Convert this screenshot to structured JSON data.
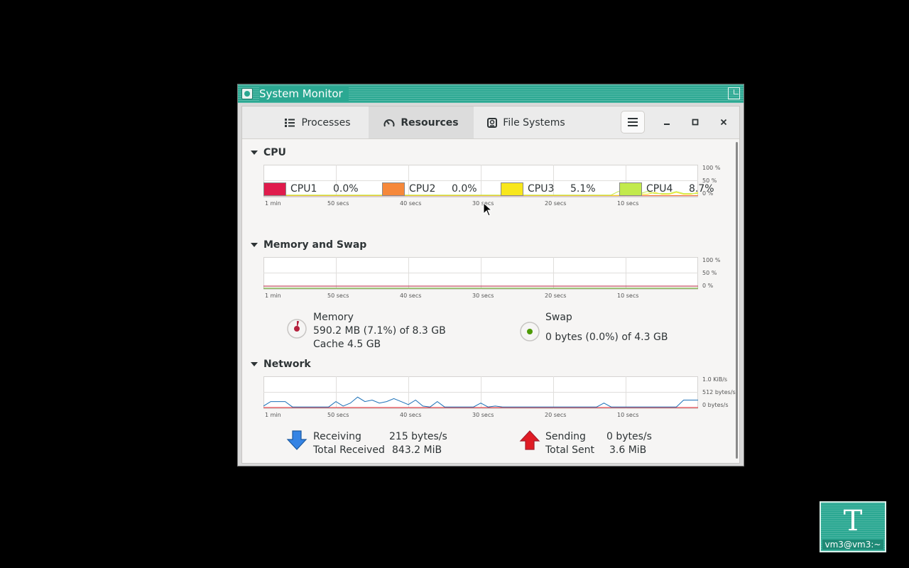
{
  "window": {
    "title": "System Monitor"
  },
  "tabs": [
    {
      "label": "Processes",
      "icon": "list-icon"
    },
    {
      "label": "Resources",
      "icon": "gauge-icon",
      "active": true
    },
    {
      "label": "File Systems",
      "icon": "disk-icon"
    }
  ],
  "sections": {
    "cpu": "CPU",
    "memory": "Memory and Swap",
    "network": "Network"
  },
  "time_labels": [
    "1 min",
    "50 secs",
    "40 secs",
    "30 secs",
    "20 secs",
    "10 secs"
  ],
  "cpu": {
    "axis": [
      "100 %",
      "50 %",
      "0 %"
    ],
    "legend": [
      {
        "name": "CPU1",
        "value": "0.0%",
        "color": "#e01b4c"
      },
      {
        "name": "CPU2",
        "value": "0.0%",
        "color": "#f6883a"
      },
      {
        "name": "CPU3",
        "value": "5.1%",
        "color": "#f8e71c"
      },
      {
        "name": "CPU4",
        "value": "8.7%",
        "color": "#c2ea4c"
      }
    ]
  },
  "memory": {
    "axis": [
      "100 %",
      "50 %",
      "0 %"
    ],
    "memory_label": "Memory",
    "memory_value": "590.2 MB (7.1%) of 8.3 GB",
    "cache": "Cache 4.5 GB",
    "memory_color": "#b5223e",
    "swap_label": "Swap",
    "swap_value": "0 bytes (0.0%) of 4.3 GB",
    "swap_color": "#4e9a06"
  },
  "network": {
    "axis": [
      "1.0 KiB/s",
      "512 bytes/s",
      "0 bytes/s"
    ],
    "receiving_label": "Receiving",
    "receiving_value": "215 bytes/s",
    "total_received_label": "Total Received",
    "total_received_value": "843.2 MiB",
    "sending_label": "Sending",
    "sending_value": "0 bytes/s",
    "total_sent_label": "Total Sent",
    "total_sent_value": "3.6 MiB",
    "receive_color": "#1c71b8",
    "send_color": "#e01b24"
  },
  "desktop": {
    "terminal_glyph": "T",
    "terminal_label": "vm3@vm3:~"
  }
}
